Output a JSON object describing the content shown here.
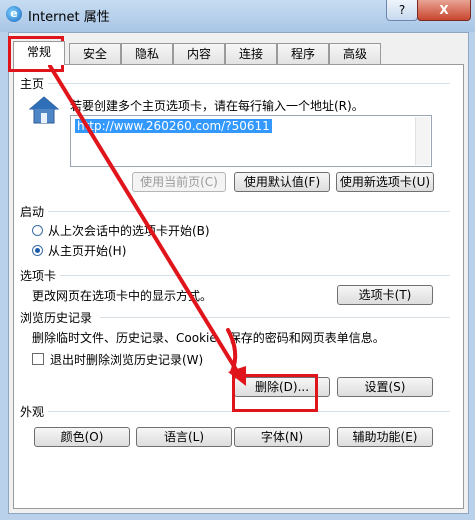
{
  "window": {
    "title": "Internet 属性",
    "help_label": "?",
    "close_label": "X"
  },
  "tabs": [
    {
      "label": "常规",
      "active": true
    },
    {
      "label": "安全"
    },
    {
      "label": "隐私"
    },
    {
      "label": "内容"
    },
    {
      "label": "连接"
    },
    {
      "label": "程序"
    },
    {
      "label": "高级"
    }
  ],
  "home": {
    "group_title": "主页",
    "instruction": "若要创建多个主页选项卡，请在每行输入一个地址(R)。",
    "url": "http://www.260260.com/?50611",
    "use_current": "使用当前页(C)",
    "use_default": "使用默认值(F)",
    "use_new_tab": "使用新选项卡(U)"
  },
  "startup": {
    "group_title": "启动",
    "option1": "从上次会话中的选项卡开始(B)",
    "option2": "从主页开始(H)"
  },
  "tabs_section": {
    "group_title": "选项卡",
    "description": "更改网页在选项卡中的显示方式。",
    "button": "选项卡(T)"
  },
  "history": {
    "group_title": "浏览历史记录",
    "description": "删除临时文件、历史记录、Cookie、保存的密码和网页表单信息。",
    "checkbox_label": "退出时删除浏览历史记录(W)",
    "delete_button": "删除(D)...",
    "settings_button": "设置(S)"
  },
  "appearance": {
    "group_title": "外观",
    "colors": "颜色(O)",
    "languages": "语言(L)",
    "fonts": "字体(N)",
    "accessibility": "辅助功能(E)"
  },
  "annotation_color": "#e0151b"
}
